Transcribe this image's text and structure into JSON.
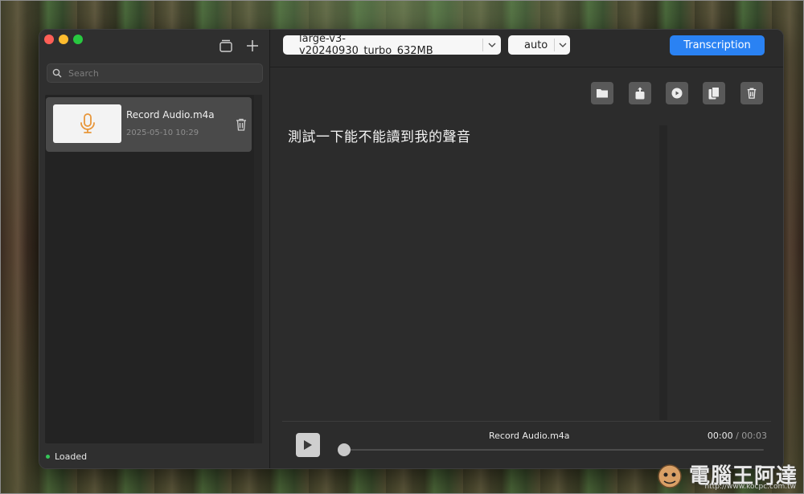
{
  "sidebar": {
    "search_placeholder": "Search",
    "items": [
      {
        "name": "Record Audio.m4a",
        "date": "2025-05-10 10:29"
      }
    ],
    "status": "Loaded"
  },
  "toolbar": {
    "model": "large-v3-v20240930_turbo_632MB",
    "language": "auto",
    "transcribe_label": "Transcription"
  },
  "transcript": {
    "text": "測試一下能不能讀到我的聲音"
  },
  "player": {
    "track_name": "Record Audio.m4a",
    "current_time": "00:00",
    "separator": " / ",
    "total_time": "00:03",
    "progress": 0.0
  },
  "watermark": {
    "title": "電腦王阿達",
    "url": "http://www.kocpc.com.tw"
  },
  "colors": {
    "accent": "#2a82f3",
    "status_dot": "#35c759",
    "mic_icon": "#e8963a"
  }
}
